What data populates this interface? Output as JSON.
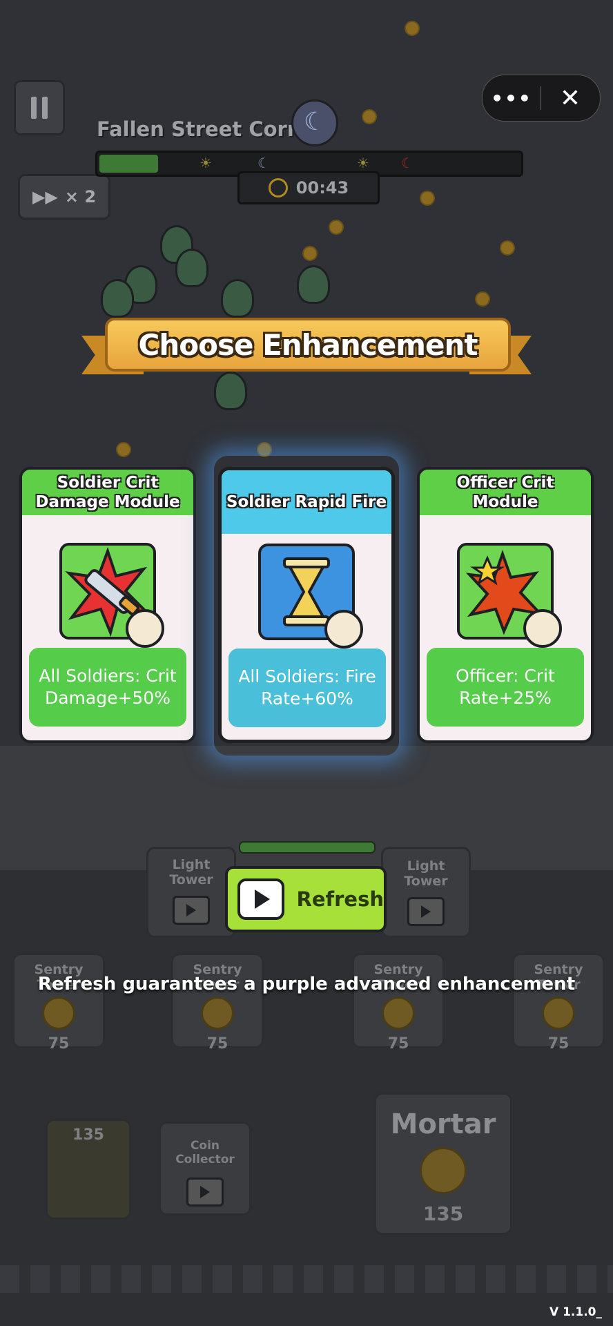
{
  "hud": {
    "level_name": "Fallen Street Corner",
    "speed_label": "× 2",
    "timer": "00:43",
    "wave_progress": 0.14
  },
  "banner": {
    "title": "Choose Enhancement"
  },
  "cards": [
    {
      "title": "Soldier Crit Damage Module",
      "desc": "All Soldiers: Crit Damage+50%",
      "rarity_color": "#5fcf47",
      "icon": "sword-burst-icon",
      "badge": "soldiers-group-icon"
    },
    {
      "title": "Soldier Rapid Fire",
      "desc": "All Soldiers: Fire Rate+60%",
      "rarity_color": "#4fc9ea",
      "icon": "hourglass-icon",
      "badge": "soldiers-group-icon",
      "selected": true
    },
    {
      "title": "Officer Crit Module",
      "desc": "Officer: Crit Rate+25%",
      "rarity_color": "#5fcf47",
      "icon": "explosion-star-icon",
      "badge": "officer-icon"
    }
  ],
  "refresh": {
    "label": "Refresh",
    "hint": "Refresh guarantees a purple advanced enhancement"
  },
  "world": {
    "light_tower_left": "Light Tower",
    "light_tower_right": "Light Tower",
    "sentry": [
      {
        "label": "Sentry Tower",
        "cost": "75"
      },
      {
        "label": "Sentry Tower",
        "cost": "75"
      },
      {
        "label": "Sentry Tower",
        "cost": "75"
      },
      {
        "label": "Sentry Tower",
        "cost": "75"
      }
    ],
    "left_cost": "135",
    "coin_collector": "Coin Collector",
    "mortar": {
      "label": "Mortar",
      "cost": "135"
    }
  },
  "version": "V 1.1.0_"
}
